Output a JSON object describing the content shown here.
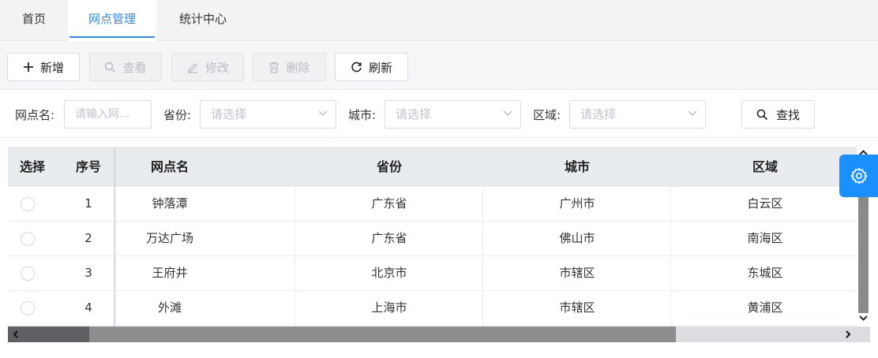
{
  "tabs": [
    {
      "label": "首页",
      "active": false
    },
    {
      "label": "网点管理",
      "active": true
    },
    {
      "label": "统计中心",
      "active": false
    }
  ],
  "toolbar": {
    "add": "新增",
    "view": "查看",
    "edit": "修改",
    "delete": "删除",
    "refresh": "刷新"
  },
  "filters": {
    "name_label": "网点名:",
    "name_placeholder": "请输入网...",
    "province_label": "省份:",
    "province_placeholder": "请选择",
    "city_label": "城市:",
    "city_placeholder": "请选择",
    "district_label": "区域:",
    "district_placeholder": "请选择",
    "find": "查找"
  },
  "table": {
    "headers": [
      "选择",
      "序号",
      "网点名",
      "省份",
      "城市",
      "区域"
    ],
    "rows": [
      {
        "index": "1",
        "name": "钟落潭",
        "province": "广东省",
        "city": "广州市",
        "district": "白云区"
      },
      {
        "index": "2",
        "name": "万达广场",
        "province": "广东省",
        "city": "佛山市",
        "district": "南海区"
      },
      {
        "index": "3",
        "name": "王府井",
        "province": "北京市",
        "city": "市辖区",
        "district": "东城区"
      },
      {
        "index": "4",
        "name": "外滩",
        "province": "上海市",
        "city": "市辖区",
        "district": "黄浦区"
      }
    ]
  },
  "colors": {
    "accent": "#2d8cf0",
    "settings_button": "#1890ff"
  }
}
